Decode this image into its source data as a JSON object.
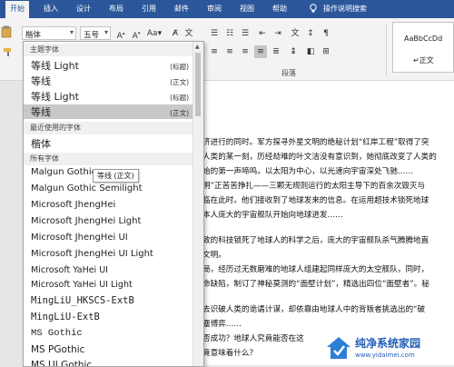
{
  "ribbon_tabs": [
    "开始",
    "插入",
    "设计",
    "布局",
    "引用",
    "邮件",
    "审阅",
    "视图",
    "帮助"
  ],
  "tell_me": "操作说明搜索",
  "font_box": {
    "value": "楷体",
    "size": "五号"
  },
  "group_labels": {
    "paragraph": "段落"
  },
  "style_preview": {
    "sample": "AaBbCcDd",
    "name": "正文"
  },
  "font_list": {
    "theme_header": "主题字体",
    "theme_items": [
      {
        "name": "等线 Light",
        "tag": "(标题)"
      },
      {
        "name": "等线",
        "tag": "(正文)"
      },
      {
        "name": "等线 Light",
        "tag": "(标题)"
      },
      {
        "name": "等线",
        "tag": "(正文)"
      }
    ],
    "recent_header": "最近使用的字体",
    "recent_items": [
      "楷体"
    ],
    "all_header": "所有字体",
    "all_items": [
      "Malgun Gothic",
      "Malgun Gothic Semilight",
      "Microsoft JhengHei",
      "Microsoft JhengHei Light",
      "Microsoft JhengHei UI",
      "Microsoft JhengHei UI Light",
      "Microsoft YaHei UI",
      "Microsoft YaHei UI Light",
      "MingLiU_HKSCS-ExtB",
      "MingLiU-ExtB",
      "MS Gothic",
      "MS PGothic",
      "MS UI Gothic"
    ],
    "tooltip": "等线 (正文)"
  },
  "document_lines": [
    "济进行的同时。军方探寻外星文明的绝秘计划“红岸工程”取得了突",
    "人类的某一刻，历经劫难的叶文洁没有意识到，她彻底改变了人类的",
    "始的第一声啼鸣，以太阳为中心，以光速向宇宙深处飞驰……",
    "明”正苦苦挣扎——三颗无规则运行的太阳主导下的百余次毁灭与",
    "临在此时。他们接收到了地球发来的信息。在运用超技术锁死地球",
    "本人庞大的宇宙舰队开始向地球进发……",
    "",
    "致的科技锁死了地球人的科学之后，庞大的宇宙舰队杀气腾腾地直",
    "文明。",
    "局，经历过无数磨难的地球人组建起同样庞大的太空舰队，同时，",
    "命缺陷，制订了神秘莫测的“面壁计划”，精选出四位“面壁者”。秘",
    "",
    "去识破人类的诡谲计谋，却依靠由地球人中的背叛者挑选出的“破",
    "塵博弈……",
    "否成功？地球人究竟能否在这",
    "竟意味着什么？"
  ],
  "watermark": {
    "title": "纯净系统家园",
    "url": "www.yidaimei.com"
  }
}
